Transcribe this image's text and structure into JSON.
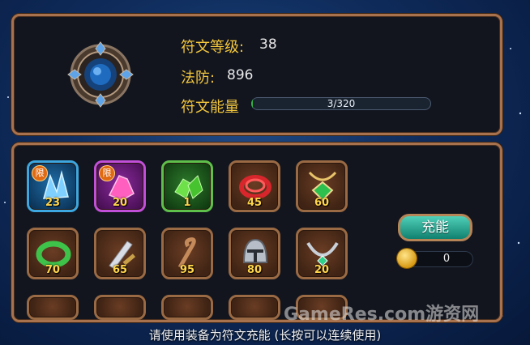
{
  "stats": {
    "rune_level_label": "符文等级:",
    "rune_level_value": "38",
    "magic_defense_label": "法防:",
    "magic_defense_value": "896",
    "rune_energy_label": "符文能量",
    "rune_energy_text": "3/320",
    "rune_energy_progress": 0.01
  },
  "items": [
    {
      "qty": "23",
      "badge": "限",
      "icon": "blue-crystal-icon",
      "rarity": "blue"
    },
    {
      "qty": "20",
      "badge": "限",
      "icon": "pink-crystal-icon",
      "rarity": "purple"
    },
    {
      "qty": "1",
      "icon": "green-crystal-icon",
      "rarity": "green"
    },
    {
      "qty": "45",
      "icon": "red-rope-icon"
    },
    {
      "qty": "60",
      "icon": "green-gem-amulet-icon"
    },
    {
      "qty": "70",
      "icon": "jade-ring-icon"
    },
    {
      "qty": "65",
      "icon": "sword-icon"
    },
    {
      "qty": "95",
      "icon": "staff-icon"
    },
    {
      "qty": "80",
      "icon": "helmet-icon"
    },
    {
      "qty": "20",
      "icon": "silver-necklace-icon"
    }
  ],
  "charge_button_label": "充能",
  "coin_value": "0",
  "hint": "请使用装备为符文充能 (长按可以连续使用)",
  "watermark": "GameRes.com游资网",
  "colors": {
    "label": "#f3c73d",
    "slot_border": "#9a6a44",
    "button": "#1fa18a"
  }
}
